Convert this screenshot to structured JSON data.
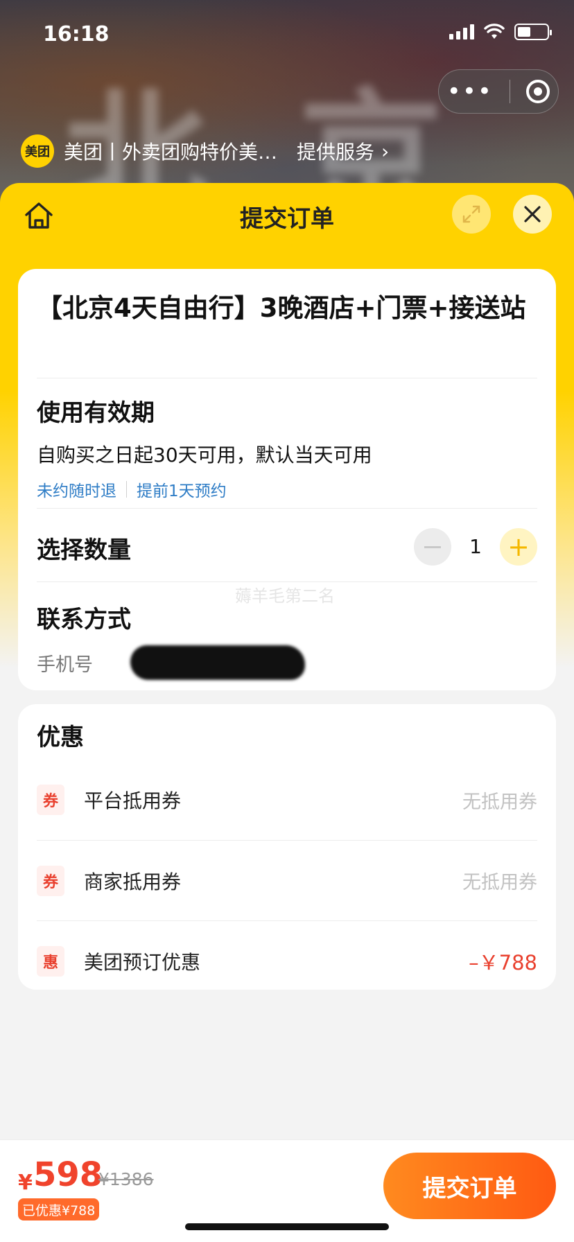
{
  "status_bar": {
    "time": "16:18",
    "battery_level": 0.45
  },
  "mini_program": {
    "logo_text": "美团",
    "title": "美团丨外卖团购特价美…",
    "service_label": "提供服务"
  },
  "sheet": {
    "title": "提交订单"
  },
  "product": {
    "title": "【北京4天自由行】3晚酒店+门票+接送站"
  },
  "validity": {
    "label": "使用有效期",
    "description": "自购买之日起30天可用，默认当天可用",
    "tags": [
      "未约随时退",
      "提前1天预约"
    ]
  },
  "quantity": {
    "label": "选择数量",
    "value": "1"
  },
  "contact": {
    "label": "联系方式",
    "phone_label": "手机号"
  },
  "watermark": "薅羊毛第二名",
  "promotions": {
    "title": "优惠",
    "items": [
      {
        "badge": "券",
        "name": "平台抵用券",
        "value": "无抵用券"
      },
      {
        "badge": "券",
        "name": "商家抵用券",
        "value": "无抵用券"
      },
      {
        "badge": "惠",
        "name": "美团预订优惠",
        "value": "–￥788"
      }
    ]
  },
  "footer": {
    "currency": "¥",
    "price": "598",
    "original_price": "¥1386",
    "saved": "已优惠¥788",
    "submit_label": "提交订单"
  },
  "colors": {
    "brand_yellow": "#ffd200",
    "price_red": "#f0432c",
    "link_blue": "#2f7dc6",
    "submit_orange": "#ff6a1a"
  }
}
